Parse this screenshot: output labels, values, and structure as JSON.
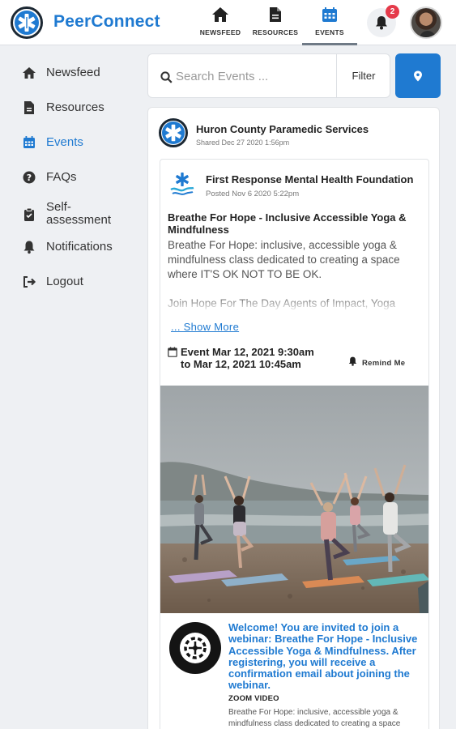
{
  "app": {
    "brand": "PeerConnect",
    "accent_color": "#1f7ad1",
    "logo_icon": "star-of-life-icon"
  },
  "header": {
    "tabs": [
      {
        "label": "NEWSFEED",
        "icon": "home-icon"
      },
      {
        "label": "RESOURCES",
        "icon": "document-icon"
      },
      {
        "label": "EVENTS",
        "icon": "calendar-icon",
        "active": true
      }
    ],
    "notification_count": "2",
    "notification_icon": "bell-icon",
    "avatar_icon": "user-avatar"
  },
  "sidebar": {
    "items": [
      {
        "label": "Newsfeed",
        "icon": "home-icon"
      },
      {
        "label": "Resources",
        "icon": "document-icon"
      },
      {
        "label": "Events",
        "icon": "calendar-icon",
        "active": true
      },
      {
        "label": "FAQs",
        "icon": "question-circle-icon"
      },
      {
        "label": "Self-assessment",
        "icon": "clipboard-icon"
      },
      {
        "label": "Notifications",
        "icon": "bell-icon"
      },
      {
        "label": "Logout",
        "icon": "logout-icon"
      }
    ]
  },
  "search": {
    "placeholder": "Search Events ...",
    "value": "",
    "filter_label": "Filter",
    "location_icon": "map-pin-icon"
  },
  "post": {
    "sharer_name": "Huron County Paramedic Services",
    "shared_label": "Shared Dec 27 2020 1:56pm",
    "event": {
      "org_name": "First Response Mental Health Foundation",
      "posted_label": "Posted Nov 6 2020 5:22pm",
      "title": "Breathe For Hope - Inclusive Accessible Yoga & Mindfulness",
      "description": "Breathe For Hope: inclusive, accessible yoga & mindfulness class dedicated to creating a space where IT'S OK NOT TO BE OK.\n\nJoin Hope For The Day Agents of Impact, Yoga",
      "show_more": "... Show More",
      "time_line1": "Event Mar 12, 2021 9:30am",
      "time_line2": "to Mar 12, 2021 10:45am",
      "remind_label": "Remind Me"
    },
    "webinar": {
      "logo_text": "HOPE FOR THE DAY · IT'S OK NOT TO BE OK",
      "title": "Welcome! You are invited to join a webinar: Breathe For Hope - Inclusive Accessible Yoga & Mindfulness. After registering, you will receive a confirmation email about joining the webinar.",
      "type_label": "ZOOM VIDEO",
      "description": "Breathe For Hope: inclusive, accessible yoga & mindfulness class dedicated to creating a space"
    }
  }
}
